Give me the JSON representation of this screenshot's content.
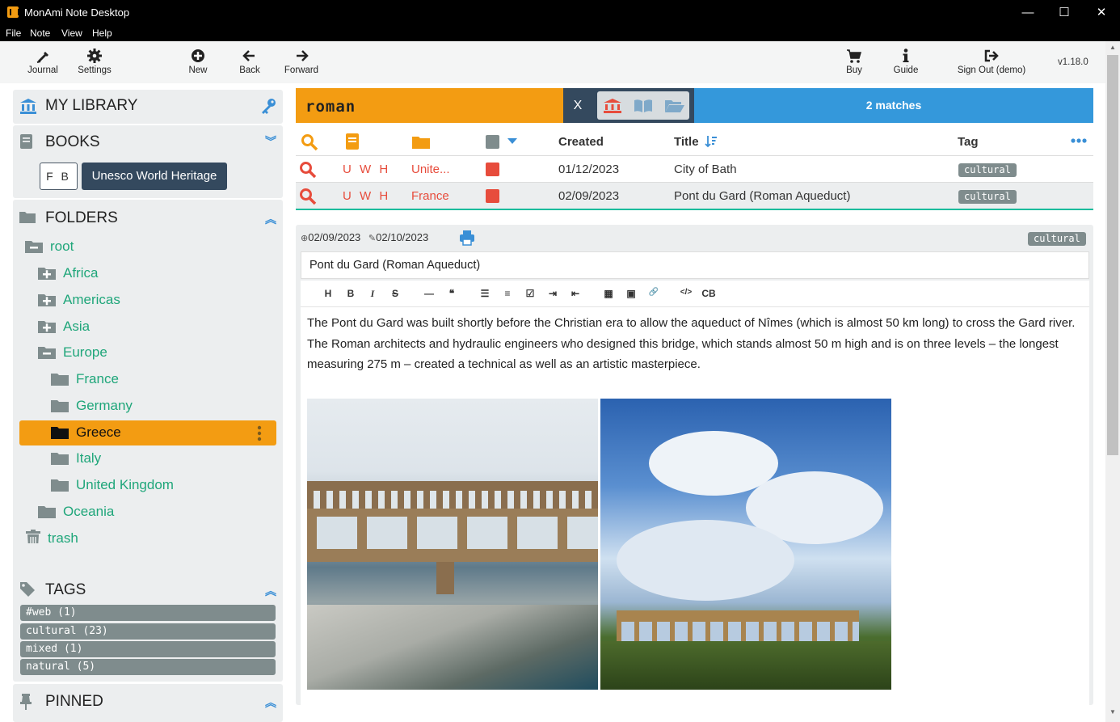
{
  "window": {
    "title": "MonAmi Note Desktop",
    "minimize": "—",
    "maximize": "☐",
    "close": "✕"
  },
  "menu": [
    "File",
    "Note",
    "View",
    "Help"
  ],
  "toolbar": {
    "journal": "Journal",
    "settings": "Settings",
    "new": "New",
    "back": "Back",
    "forward": "Forward",
    "buy": "Buy",
    "guide": "Guide",
    "signout": "Sign Out (demo)",
    "version": "v1.18.0"
  },
  "sidebar": {
    "library_title": "MY LIBRARY",
    "books_title": "BOOKS",
    "books": {
      "fb": "F B",
      "selected_book": "Unesco World Heritage"
    },
    "folders_title": "FOLDERS",
    "folders": [
      "root",
      "Africa",
      "Americas",
      "Asia",
      "Europe",
      "France",
      "Germany",
      "Greece",
      "Italy",
      "United Kingdom",
      "Oceania",
      "trash"
    ],
    "selected_folder": "Greece",
    "tags_title": "TAGS",
    "tags": [
      "#web (1)",
      "cultural (23)",
      "mixed (1)",
      "natural (5)"
    ],
    "pinned_title": "PINNED"
  },
  "search": {
    "query": "roman",
    "clear": "X",
    "matches": "2 matches"
  },
  "results": {
    "headers": {
      "created": "Created",
      "title": "Title",
      "tag": "Tag"
    },
    "rows": [
      {
        "book": "U W H",
        "folder": "Unite...",
        "created": "01/12/2023",
        "title": "City of Bath",
        "tag": "cultural"
      },
      {
        "book": "U W H",
        "folder": "France",
        "created": "02/09/2023",
        "title": "Pont du Gard (Roman Aqueduct)",
        "tag": "cultural"
      }
    ]
  },
  "note": {
    "created": "02/09/2023",
    "modified": "02/10/2023",
    "tag": "cultural",
    "title": "Pont du Gard (Roman Aqueduct)",
    "format_buttons": [
      "H",
      "B",
      "I",
      "S",
      "—",
      "❝",
      "☰",
      "≡",
      "☑",
      "⇥",
      "⇤",
      "▦",
      "▣",
      "🔗",
      "</>",
      "CB"
    ],
    "body": "The Pont du Gard was built shortly before the Christian era to allow the aqueduct of Nîmes (which is almost 50 km long) to cross the Gard river. The Roman architects and hydraulic engineers who designed this bridge, which stands almost 50 m high and is on three levels – the longest measuring 275 m – created a technical as well as an artistic masterpiece."
  },
  "colors": {
    "accent": "#f39c12",
    "dark": "#34495e",
    "blue": "#3498db",
    "green": "#1fa67a",
    "red": "#e74c3c",
    "tag": "#7f8c8d"
  }
}
